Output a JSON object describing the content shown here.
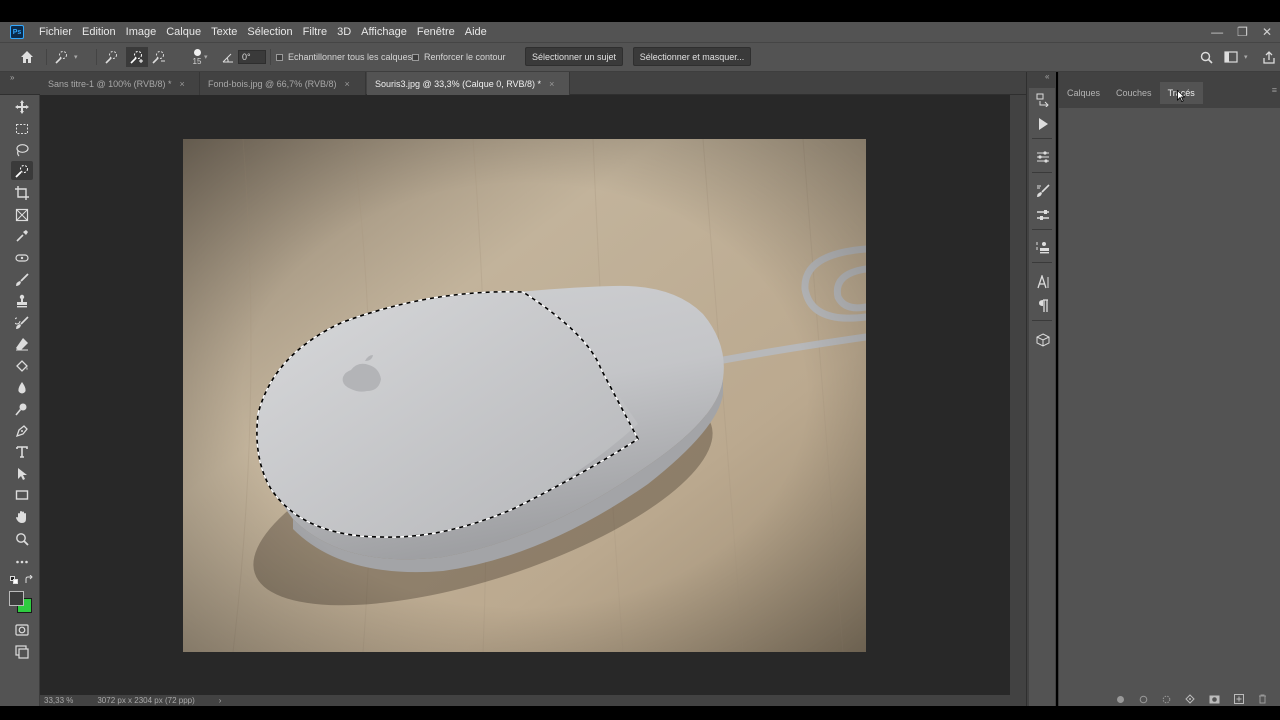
{
  "menubar": {
    "app_icon": "Ps",
    "items": [
      "Fichier",
      "Edition",
      "Image",
      "Calque",
      "Texte",
      "Sélection",
      "Filtre",
      "3D",
      "Affichage",
      "Fenêtre",
      "Aide"
    ],
    "window_controls": {
      "minimize": "—",
      "restore": "❐",
      "close": "✕"
    }
  },
  "options": {
    "brush_size": "15",
    "angle_value": "0°",
    "sample_all_layers": "Echantillonner tous les calques",
    "enhance_edge": "Renforcer le contour",
    "select_subject": "Sélectionner un sujet",
    "select_and_mask": "Sélectionner et masquer..."
  },
  "tabs": [
    {
      "label": "Sans titre-1 @ 100% (RVB/8) *",
      "active": false
    },
    {
      "label": "Fond-bois.jpg @ 66,7% (RVB/8)",
      "active": false
    },
    {
      "label": "Souris3.jpg @ 33,3% (Calque 0, RVB/8) *",
      "active": true
    }
  ],
  "tab_close": "×",
  "status": {
    "zoom": "33,33 %",
    "doc_size": "3072 px x 2304 px (72 ppp)",
    "arrow": "›"
  },
  "panel": {
    "tabs": [
      "Calques",
      "Couches",
      "Tracés"
    ],
    "active_tab": "Tracés",
    "menu_icon": "≡"
  },
  "colors": {
    "foreground": "#3d3d3d",
    "background": "#2ecc40",
    "ui_dark": "#535353",
    "canvas_bg": "#282828"
  },
  "icons": {
    "dock": [
      "history-icon",
      "actions-play-icon",
      "properties-icon",
      "brush-settings-icon",
      "brushes-icon",
      "clone-source-icon",
      "character-icon",
      "paragraph-icon",
      "3d-icon"
    ],
    "tools": [
      "move-icon",
      "marquee-icon",
      "lasso-icon",
      "quick-select-icon",
      "crop-icon",
      "frame-icon",
      "eyedropper-icon",
      "healing-icon",
      "brush-icon",
      "stamp-icon",
      "history-brush-icon",
      "eraser-icon",
      "paint-bucket-icon",
      "blur-icon",
      "dodge-icon",
      "pen-icon",
      "type-icon",
      "path-select-icon",
      "rectangle-icon",
      "hand-icon",
      "zoom-icon",
      "more-tools-icon"
    ]
  }
}
